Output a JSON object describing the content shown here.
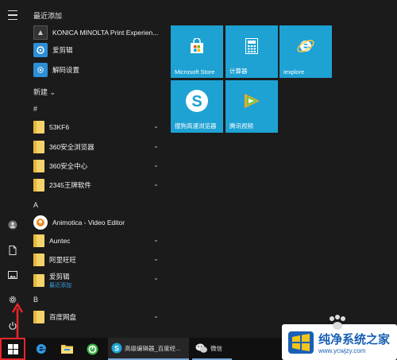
{
  "sections": {
    "recent": "最近添加",
    "new_app": "新建",
    "hash": "#",
    "a": "A",
    "b": "B"
  },
  "recent_items": [
    {
      "label": "KONICA MINOLTA Print Experien...",
      "icon": "konica-icon"
    },
    {
      "label": "爱剪辑",
      "icon": "aijianji-icon"
    },
    {
      "label": "解码设置",
      "icon": "decode-settings-icon"
    }
  ],
  "apps": [
    {
      "label": "53KF6",
      "icon": "folder-icon",
      "expand": true
    },
    {
      "label": "360安全浏览器",
      "icon": "folder-icon",
      "expand": true
    },
    {
      "label": "360安全中心",
      "icon": "folder-icon",
      "expand": true
    },
    {
      "label": "2345王牌软件",
      "icon": "folder-icon",
      "expand": true
    },
    {
      "label": "Animotica - Video Editor",
      "icon": "animotica-icon",
      "expand": false
    },
    {
      "label": "Auntec",
      "icon": "folder-icon",
      "expand": true
    },
    {
      "label": "阿里旺旺",
      "icon": "folder-icon",
      "expand": true
    },
    {
      "label": "爱剪辑",
      "sublabel": "最近添加",
      "icon": "folder-icon",
      "expand": true
    },
    {
      "label": "百度网盘",
      "icon": "folder-icon",
      "expand": true
    }
  ],
  "tiles": [
    {
      "label": "Microsoft Store",
      "icon": "store-icon"
    },
    {
      "label": "计算器",
      "icon": "calculator-icon"
    },
    {
      "label": "iexplore",
      "icon": "ie-icon"
    },
    {
      "label": "搜狗高速浏览器",
      "icon": "sogou-icon"
    },
    {
      "label": "腾讯视频",
      "icon": "tencent-video-icon"
    }
  ],
  "taskbar": {
    "editor": "高级编辑器_百度经...",
    "wechat": "微信"
  },
  "watermark": {
    "title": "纯净系统之家",
    "url": "www.ycwjzy.com"
  },
  "colors": {
    "tile": "#1ea2d3",
    "highlight": "#e8262a",
    "background": "#1b1b1b"
  }
}
